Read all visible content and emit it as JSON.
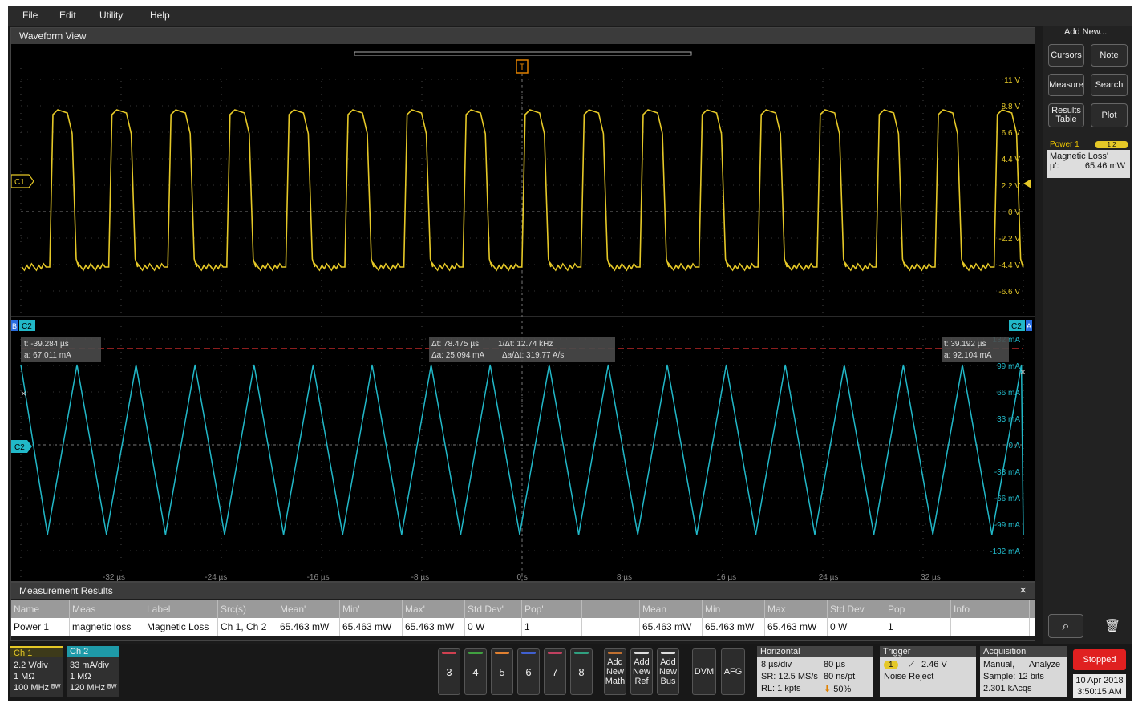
{
  "menu": [
    "File",
    "Edit",
    "Utility",
    "Help"
  ],
  "waveform_view": {
    "title": "Waveform View",
    "ch1_axis": [
      "11 V",
      "8.8 V",
      "6.6 V",
      "4.4 V",
      "2.2 V",
      "0 V",
      "-2.2 V",
      "-4.4 V",
      "-6.6 V"
    ],
    "ch2_axis": [
      "132 mA",
      "99 mA",
      "66 mA",
      "33 mA",
      "0 A",
      "-33 mA",
      "-66 mA",
      "-99 mA",
      "-132 mA"
    ],
    "time_axis": [
      "-32 µs",
      "-24 µs",
      "-16 µs",
      "-8 µs",
      "0 s",
      "8 µs",
      "16 µs",
      "24 µs",
      "32 µs"
    ],
    "ch1_tag": "C1",
    "ch2_tag": "C2",
    "ch2_badge": "C2",
    "b_tag": "B",
    "a_tag": "A",
    "trigger_marker": "T",
    "cursor_a": {
      "t": "t: -39.284 µs",
      "a": "a: 67.011 mA"
    },
    "cursor_delta": {
      "dt": "Δt: 78.475 µs",
      "inv": "1/Δt: 12.74 kHz",
      "da": "Δa: 25.094 mA",
      "ratio": "Δa/Δt: 319.77 A/s"
    },
    "cursor_b": {
      "t": "t: 39.192 µs",
      "a": "a: 92.104 mA"
    },
    "colors": {
      "ch1": "#e5c827",
      "ch2": "#21b8c8",
      "cursor": "#e03030"
    }
  },
  "right_panel": {
    "add_new": "Add New...",
    "buttons": [
      "Cursors",
      "Note",
      "Measure",
      "Search",
      "Results Table",
      "Plot"
    ],
    "power_card": {
      "title": "Power 1",
      "badge": "1 2",
      "meas": "Magnetic Loss'",
      "label": "µ':",
      "value": "65.46 mW"
    }
  },
  "measurement_results": {
    "title": "Measurement Results",
    "close": "×",
    "columns": [
      "Name",
      "Meas",
      "Label",
      "Src(s)",
      "Mean'",
      "Min'",
      "Max'",
      "Std Dev'",
      "Pop'",
      "",
      "Mean",
      "Min",
      "Max",
      "Std Dev",
      "Pop",
      "Info"
    ],
    "row": [
      "Power 1",
      "magnetic loss",
      "Magnetic Loss",
      "Ch 1, Ch 2",
      "65.463 mW",
      "65.463 mW",
      "65.463 mW",
      "0 W",
      "1",
      "",
      "65.463 mW",
      "65.463 mW",
      "65.463 mW",
      "0 W",
      "1",
      ""
    ]
  },
  "bottom": {
    "ch1": {
      "title": "Ch 1",
      "lines": [
        "2.2 V/div",
        "1 MΩ",
        "100 MHz ᴮᵂ"
      ]
    },
    "ch2": {
      "title": "Ch 2",
      "lines": [
        "33 mA/div",
        "1 MΩ",
        "120 MHz ᴮᵂ"
      ]
    },
    "num_buttons": [
      "3",
      "4",
      "5",
      "6",
      "7",
      "8"
    ],
    "add_buttons": [
      [
        "Add",
        "New",
        "Math"
      ],
      [
        "Add",
        "New",
        "Ref"
      ],
      [
        "Add",
        "New",
        "Bus"
      ]
    ],
    "dvm": "DVM",
    "afg": "AFG",
    "horizontal": {
      "title": "Horizontal",
      "scale": "8 µs/div",
      "pos": "80 µs",
      "sr": "SR: 12.5 MS/s",
      "pt": "80 ns/pt",
      "rl": "RL: 1 kpts",
      "pct": "50%"
    },
    "trigger": {
      "title": "Trigger",
      "ch": "1",
      "level": "2.46 V",
      "mode": "Noise Reject"
    },
    "acquisition": {
      "title": "Acquisition",
      "mode": "Manual,",
      "analyze": "Analyze",
      "sample": "Sample: 12 bits",
      "acqs": "2.301 kAcqs"
    },
    "stopped": "Stopped",
    "date": "10 Apr 2018",
    "time": "3:50:15 AM"
  }
}
